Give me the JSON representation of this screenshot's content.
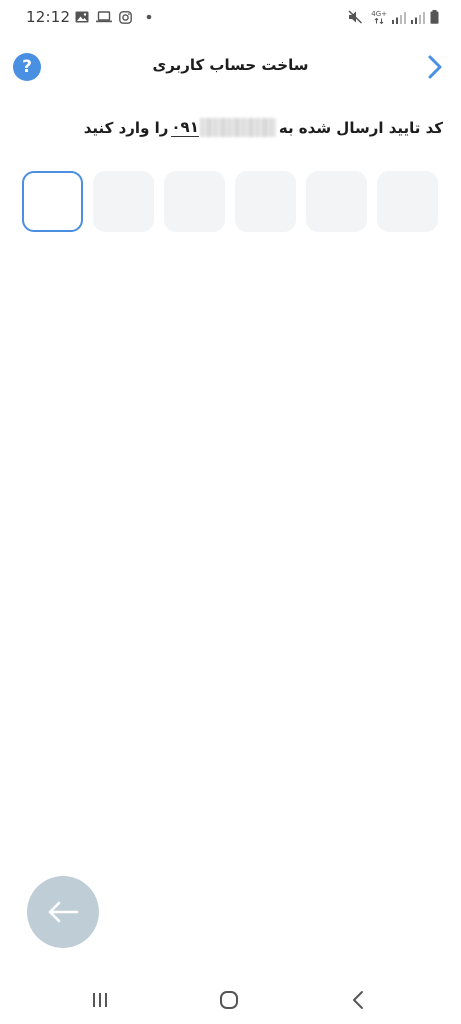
{
  "status_bar": {
    "time": "12:12",
    "network_label": "4G+",
    "left_icons": [
      "gallery-icon",
      "laptop-icon",
      "instagram-icon",
      "dot-icon"
    ],
    "right_icons": [
      "mute-icon",
      "network-4g-icon",
      "signal-icon",
      "signal-icon",
      "battery-icon"
    ]
  },
  "header": {
    "title": "ساخت حساب کاربری",
    "help_label": "?",
    "back_icon": "chevron-right-icon"
  },
  "instruction": {
    "before": "کد تایید ارسال شده به",
    "phone_prefix": "۰۹۱",
    "after": "را وارد کنید"
  },
  "otp": {
    "digits": [
      "",
      "",
      "",
      "",
      "",
      ""
    ],
    "active_index": 0
  },
  "fab": {
    "icon": "arrow-left-icon"
  },
  "nav_bar": {
    "items": [
      "recents-icon",
      "home-icon",
      "back-icon"
    ]
  },
  "colors": {
    "accent": "#4a90e2",
    "otp_box": "#f2f4f6",
    "fab_bg": "#bfcdd7"
  }
}
